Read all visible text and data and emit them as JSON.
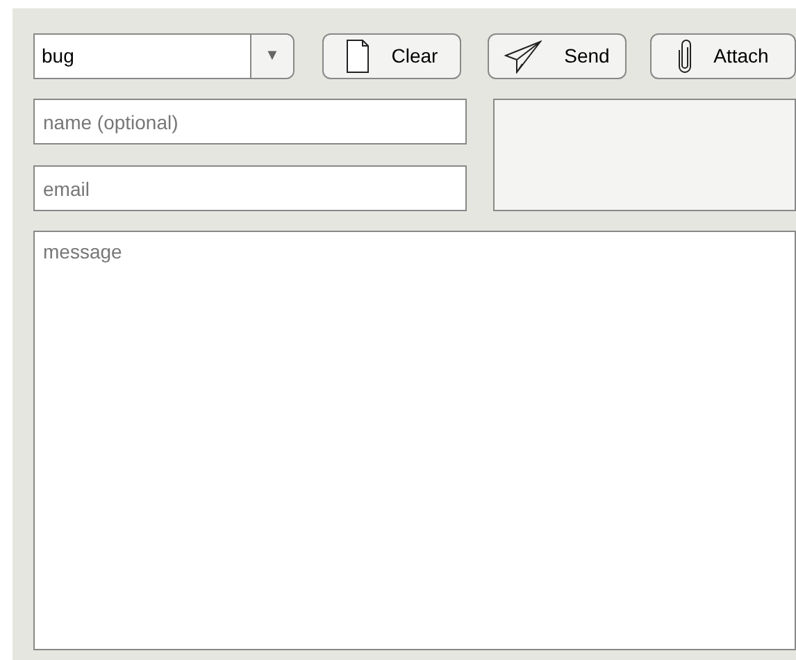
{
  "category_select": {
    "value": "bug",
    "arrow": "▼"
  },
  "buttons": [
    {
      "label": "Clear",
      "kind": "document"
    },
    {
      "label": "Send",
      "kind": "plane"
    },
    {
      "label": "Attach",
      "kind": "clip"
    }
  ],
  "name_field": {
    "placeholder": "name (optional)"
  },
  "email_field": {
    "placeholder": "email"
  },
  "message_field": {
    "placeholder": "message"
  }
}
